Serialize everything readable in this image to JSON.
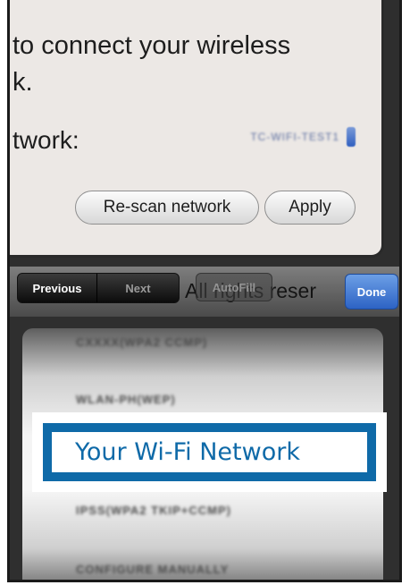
{
  "dialog": {
    "instruction": "to connect your wireless\nk.",
    "network_label": "twork:",
    "network_value": "TC-WIFI-TEST1",
    "rescan_label": "Re-scan network",
    "apply_label": "Apply"
  },
  "toolbar": {
    "previous_label": "Previous",
    "next_label": "Next",
    "autofill_label": "AutoFill",
    "done_label": "Done",
    "background_text": "All rights reser"
  },
  "picker": {
    "items": [
      "CXXXX(WPA2 CCMP)",
      "WLAN-PH(WEP)",
      "Your Wi-Fi Network",
      "IPSS(WPA2 TKIP+CCMP)",
      "CONFIGURE MANUALLY"
    ]
  },
  "callout": {
    "label": "Your Wi-Fi Network",
    "color": "#0f6aa8"
  },
  "colors": {
    "done_button": "#2d63c4",
    "dialog_bg": "#ece8e5",
    "toolbar_bg": "#5a5a5a"
  }
}
